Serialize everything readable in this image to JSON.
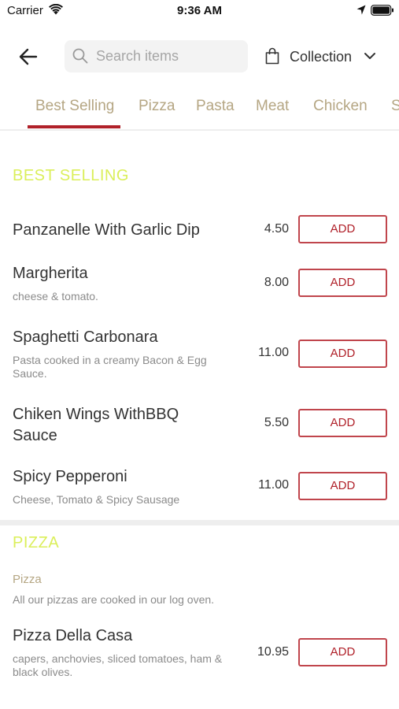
{
  "status_bar": {
    "carrier": "Carrier",
    "time": "9:36 AM"
  },
  "header": {
    "search_placeholder": "Search items",
    "collection_label": "Collection"
  },
  "tabs": [
    {
      "label": "Best Selling",
      "active": true
    },
    {
      "label": "Pizza",
      "active": false
    },
    {
      "label": "Pasta",
      "active": false
    },
    {
      "label": "Meat",
      "active": false
    },
    {
      "label": "Chicken",
      "active": false
    },
    {
      "label": "S",
      "active": false
    }
  ],
  "colors": {
    "accent": "#b02029",
    "tab_text": "#b5a683",
    "section_title": "#dbef5a"
  },
  "sections": {
    "best_selling": {
      "title": "BEST SELLING",
      "items": [
        {
          "name": "Panzanelle With Garlic Dip",
          "desc": "",
          "price": "4.50",
          "button": "ADD"
        },
        {
          "name": "Margherita",
          "desc": "cheese & tomato.",
          "price": "8.00",
          "button": "ADD"
        },
        {
          "name": "Spaghetti Carbonara",
          "desc": "Pasta cooked in a creamy Bacon & Egg Sauce.",
          "price": "11.00",
          "button": "ADD"
        },
        {
          "name": "Chiken Wings WithBBQ Sauce",
          "desc": "",
          "price": "5.50",
          "button": "ADD"
        },
        {
          "name": "Spicy Pepperoni",
          "desc": "Cheese, Tomato & Spicy Sausage",
          "price": "11.00",
          "button": "ADD"
        }
      ]
    },
    "pizza": {
      "title": "PIZZA",
      "subtitle": "Pizza",
      "description": "All our pizzas are cooked in our log oven.",
      "items": [
        {
          "name": "Pizza Della Casa",
          "desc": "capers, anchovies, sliced tomatoes, ham & black olives.",
          "price": "10.95",
          "button": "ADD"
        }
      ]
    }
  }
}
